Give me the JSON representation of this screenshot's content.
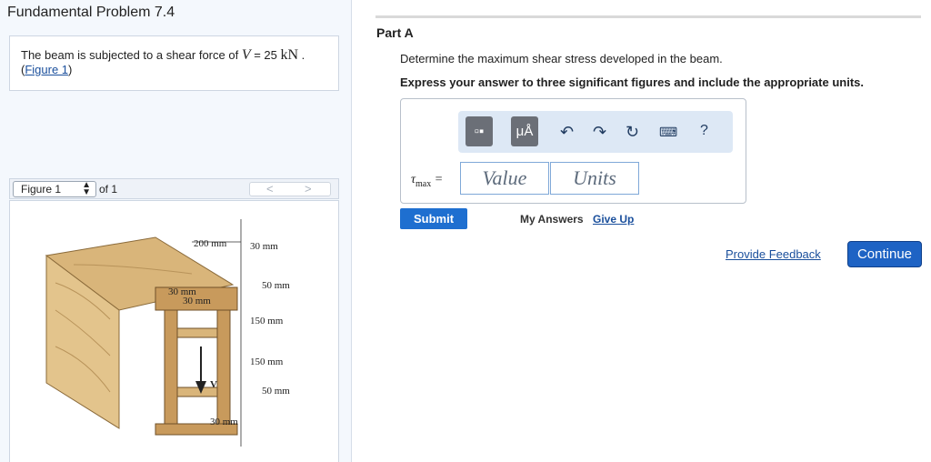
{
  "problem": {
    "title": "Fundamental Problem 7.4",
    "text_prefix": "The beam is subjected to a shear force of ",
    "var": "V",
    "eq": " = 25 ",
    "unit": "kN",
    "period": " .",
    "figure_link": "Figure 1"
  },
  "figure": {
    "select_value": "Figure 1",
    "of_text": "of 1",
    "prev": "<",
    "next": ">",
    "labels": {
      "w200": "200 mm",
      "t30_top": "30 mm",
      "t30a": "30 mm",
      "t30b": "30 mm",
      "h50_top": "50 mm",
      "h150a": "150 mm",
      "h150b": "150 mm",
      "h50_bot": "50 mm",
      "t30_bot": "30 mm",
      "v": "V"
    }
  },
  "part": {
    "label": "Part A",
    "question": "Determine the maximum shear stress developed in the beam.",
    "instruction": "Express your answer to three significant figures and include the appropriate units."
  },
  "answer": {
    "var": "τ",
    "sub": "max",
    "eq": " =",
    "value_placeholder": "Value",
    "units_placeholder": "Units",
    "toolbar_units_label": "μÅ",
    "help": "?"
  },
  "actions": {
    "submit": "Submit",
    "my_answers": "My Answers",
    "give_up": "Give Up",
    "feedback": "Provide Feedback",
    "continue": "Continue"
  }
}
